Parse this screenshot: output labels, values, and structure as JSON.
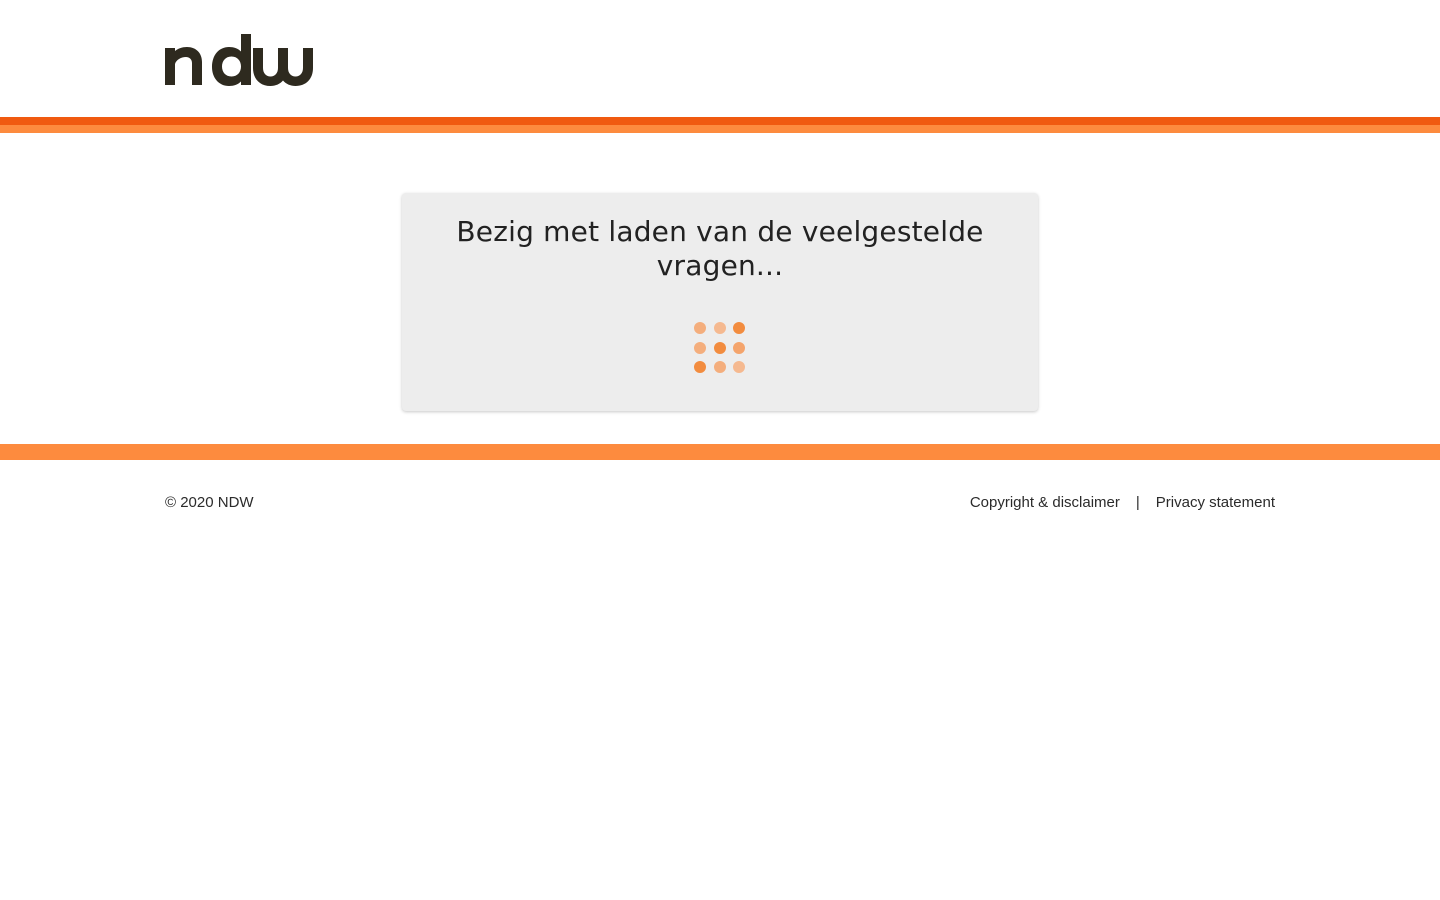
{
  "header": {
    "logo_text": "ndw",
    "logo_color": "#2e2a1f"
  },
  "colors": {
    "stripe_dark": "#f05a10",
    "stripe_light": "#fd8b3e",
    "card_bg": "#ededed",
    "spinner_strong": "#f28c3f",
    "spinner_faint": "#f4ae7d"
  },
  "loading": {
    "message": "Bezig met laden van de veelgestelde vragen..."
  },
  "footer": {
    "copyright": "© 2020 NDW",
    "links": [
      {
        "label": "Copyright & disclaimer"
      },
      {
        "label": "Privacy statement"
      }
    ],
    "separator": "|"
  }
}
